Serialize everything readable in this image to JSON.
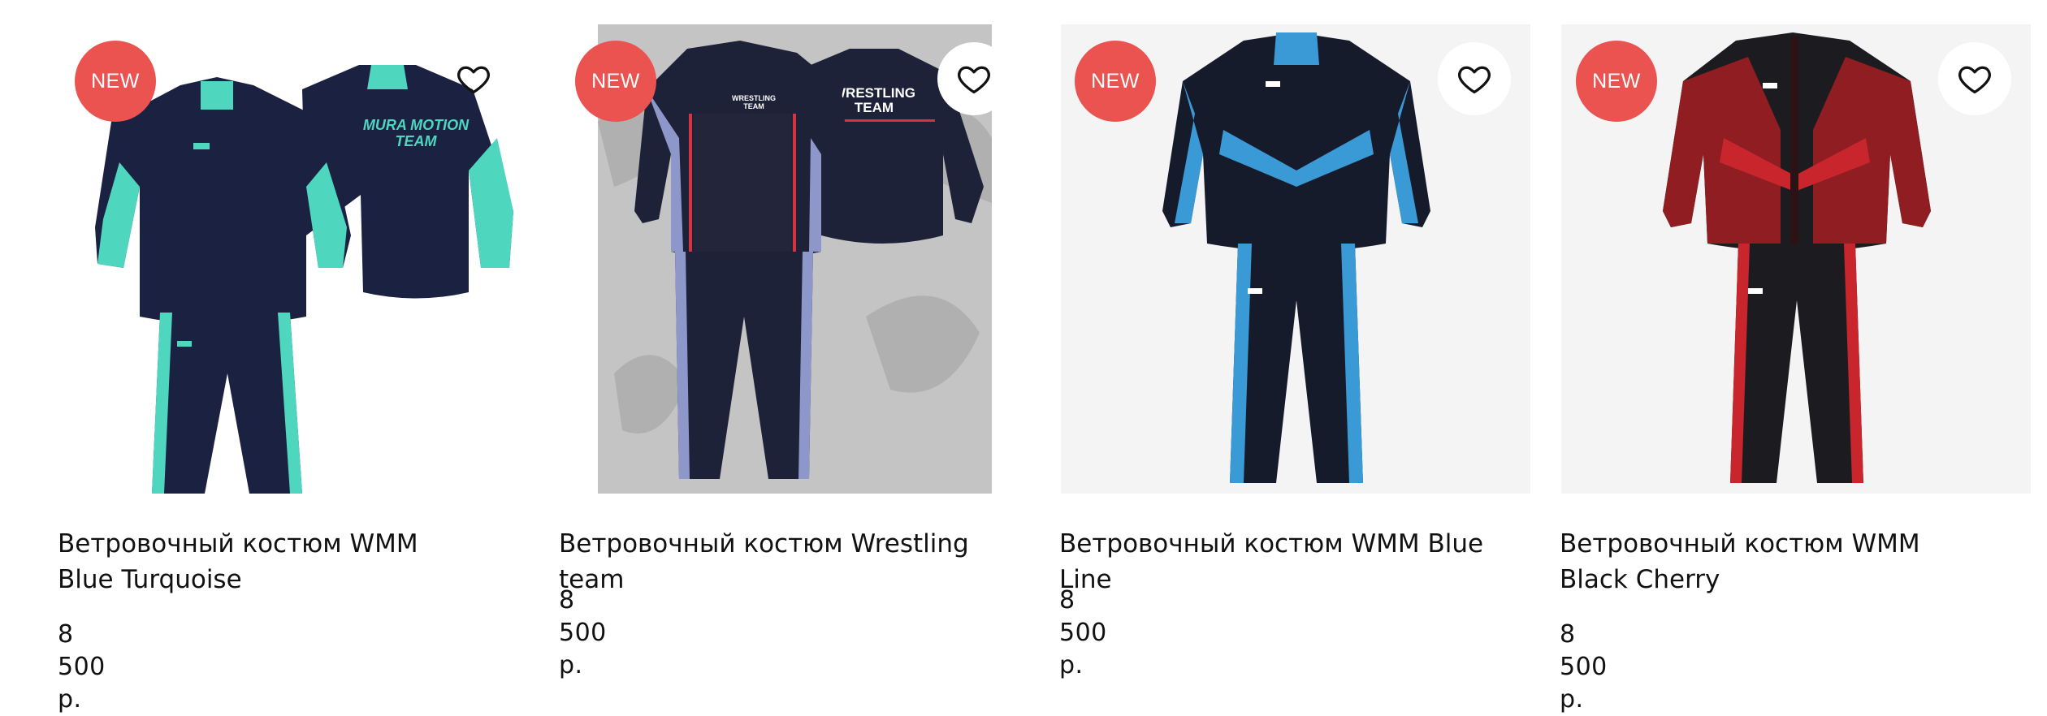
{
  "products": [
    {
      "badge": "NEW",
      "title": "Ветровочный костюм WMM Blue Turquoise",
      "price": "8 500 р.",
      "print": "MURA MOTION TEAM",
      "colors": {
        "body": "#1b2140",
        "accent": "#4fd6bf"
      },
      "favorite_icon": "heart-outline-icon"
    },
    {
      "badge": "NEW",
      "title": "Ветровочный костюм Wrestling team",
      "price": "8 500 р.",
      "print": "WRESTLING TEAM",
      "colors": {
        "body": "#1e2238",
        "accent": "#8d97c9",
        "stripe": "#d4343e"
      },
      "favorite_icon": "heart-outline-icon"
    },
    {
      "badge": "NEW",
      "title": "Ветровочный костюм WMM Blue Line",
      "price": "8 500 р.",
      "colors": {
        "body": "#161b2c",
        "accent": "#3a9ad6"
      },
      "favorite_icon": "heart-outline-icon"
    },
    {
      "badge": "NEW",
      "title": "Ветровочный костюм WMM Black Cherry",
      "price": "8 500 р.",
      "colors": {
        "body": "#1c1c20",
        "accent": "#c8262c"
      },
      "favorite_icon": "heart-outline-icon"
    }
  ],
  "theme": {
    "badge_color": "#ea5350",
    "image_bg": "#f4f4f4"
  }
}
